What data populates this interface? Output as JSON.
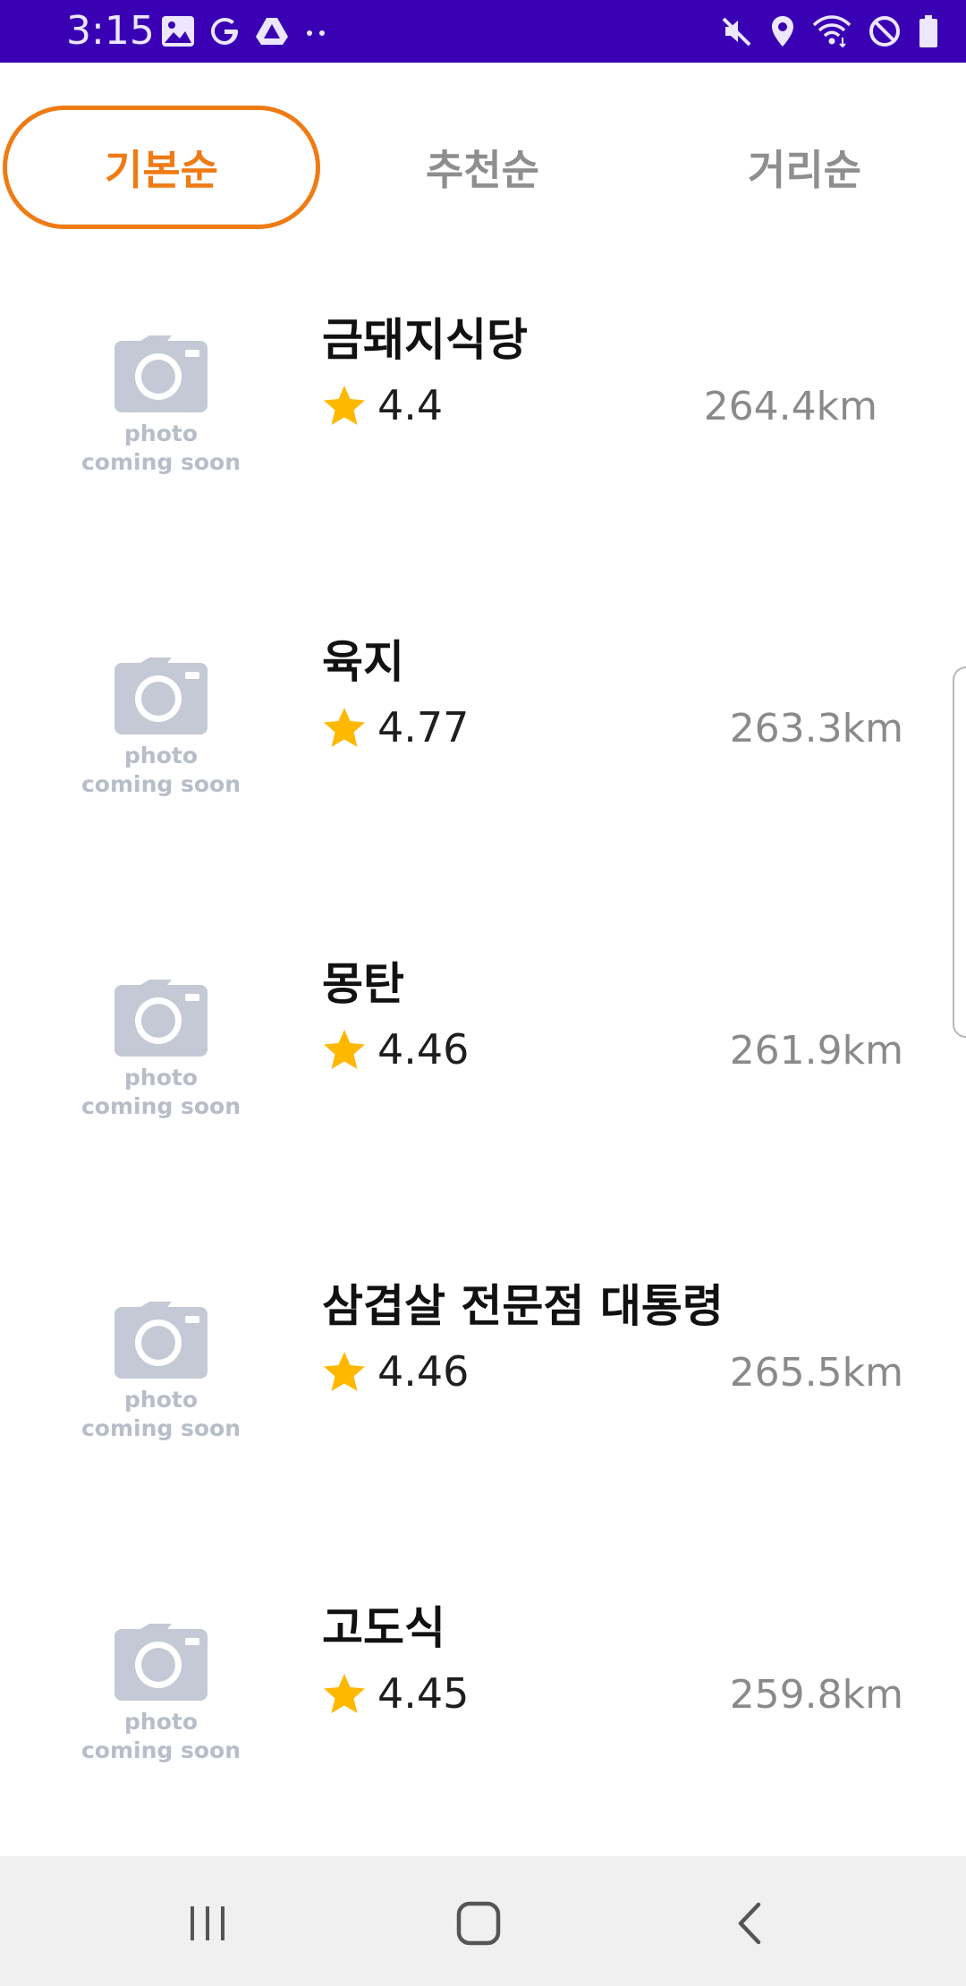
{
  "status_bar": {
    "time": "3:15",
    "background": "#3a01b4",
    "left_icons": [
      "gallery-icon",
      "google-g-icon",
      "drive-icon",
      "more-dots-icon"
    ],
    "right_icons": [
      "mute-icon",
      "location-icon",
      "wifi-icon",
      "do-not-disturb-icon",
      "battery-icon"
    ]
  },
  "tabs": [
    {
      "label": "기본순",
      "active": true
    },
    {
      "label": "추천순",
      "active": false
    },
    {
      "label": "거리순",
      "active": false
    }
  ],
  "accent_color": "#ef7b14",
  "star_color": "#ffb800",
  "placeholder": {
    "line1": "photo",
    "line2": "coming soon"
  },
  "restaurants": [
    {
      "name": "금돼지식당",
      "rating": "4.4",
      "distance": "264.4km"
    },
    {
      "name": "육지",
      "rating": "4.77",
      "distance": "263.3km"
    },
    {
      "name": "몽탄",
      "rating": "4.46",
      "distance": "261.9km"
    },
    {
      "name": "삼겹살 전문점 대통령",
      "rating": "4.46",
      "distance": "265.5km"
    },
    {
      "name": "고도식",
      "rating": "4.45",
      "distance": "259.8km"
    }
  ],
  "nav_bar": {
    "buttons": [
      "recent-apps-icon",
      "home-icon",
      "back-icon"
    ]
  }
}
